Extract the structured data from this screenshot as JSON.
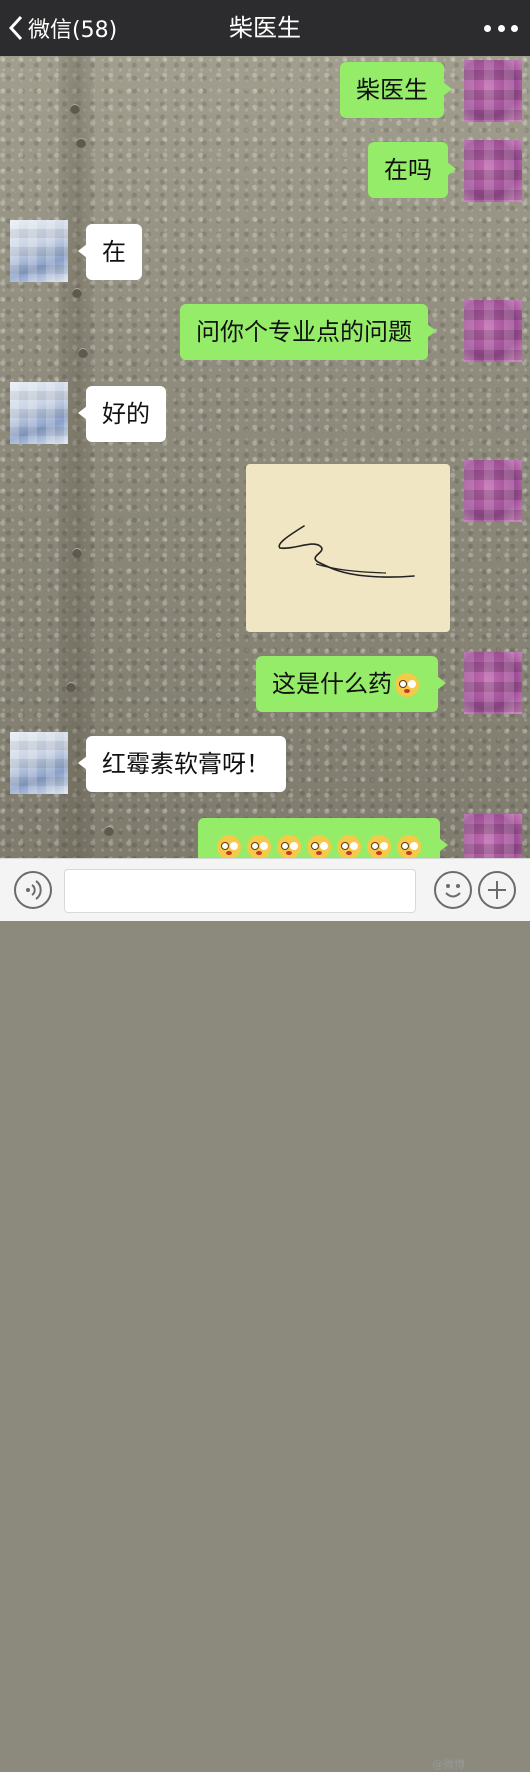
{
  "header": {
    "back_label": "微信(58)",
    "title": "柴医生"
  },
  "messages": [
    {
      "side": "right",
      "text": "柴医生"
    },
    {
      "side": "right",
      "text": "在吗"
    },
    {
      "side": "left",
      "text": "在"
    },
    {
      "side": "right",
      "text": "问你个专业点的问题"
    },
    {
      "side": "left",
      "text": "好的"
    },
    {
      "side": "right",
      "type": "image",
      "content": "photo of a scribbled signature"
    },
    {
      "side": "right",
      "text": "这是什么药",
      "emoji_count": 1
    },
    {
      "side": "left",
      "text": "红霉素软膏呀！"
    },
    {
      "side": "right",
      "text": "",
      "emoji_count": 7
    }
  ],
  "icons": {
    "back": "chevron-left-icon",
    "more": "more-dots-icon",
    "voice": "voice-icon",
    "emoji": "emoji-icon",
    "plus": "plus-icon",
    "reaction": "flushed-face-emoji"
  },
  "colors": {
    "header_bg": "#2c2c2e",
    "sent_bubble": "#95ec69",
    "received_bubble": "#ffffff",
    "input_bar_bg": "#f4f4f4"
  },
  "input": {
    "value": "",
    "placeholder": ""
  },
  "watermark": "@微博"
}
